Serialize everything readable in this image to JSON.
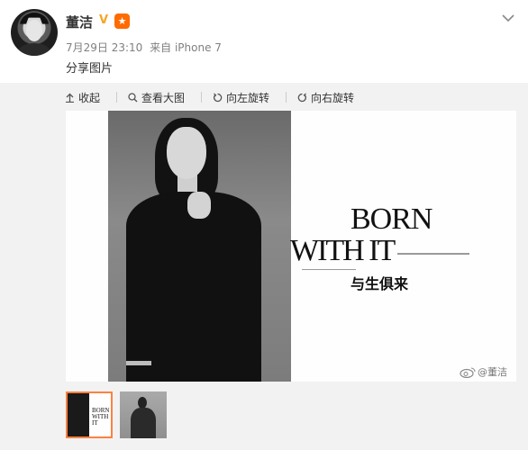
{
  "user": {
    "name": "董洁",
    "verified_badge": "V",
    "medal_icon": "medal-icon"
  },
  "post": {
    "date": "7月29日 23:10",
    "source": "来自 iPhone 7",
    "text": "分享图片"
  },
  "toolbar": {
    "collapse": "收起",
    "view_large": "查看大图",
    "rotate_left": "向左旋转",
    "rotate_right": "向右旋转"
  },
  "image": {
    "title_line1": "BORN",
    "title_line2": "WITH IT",
    "title_cn": "与生俱来",
    "watermark": "@董洁"
  },
  "thumbnails": {
    "thumb1_text": "BORN WITH IT",
    "active_index": 0,
    "count": 2
  },
  "colors": {
    "accent": "#ff8140",
    "verified": "#f5a623",
    "medal": "#ff6b00",
    "media_bg": "#f2f2f2"
  }
}
